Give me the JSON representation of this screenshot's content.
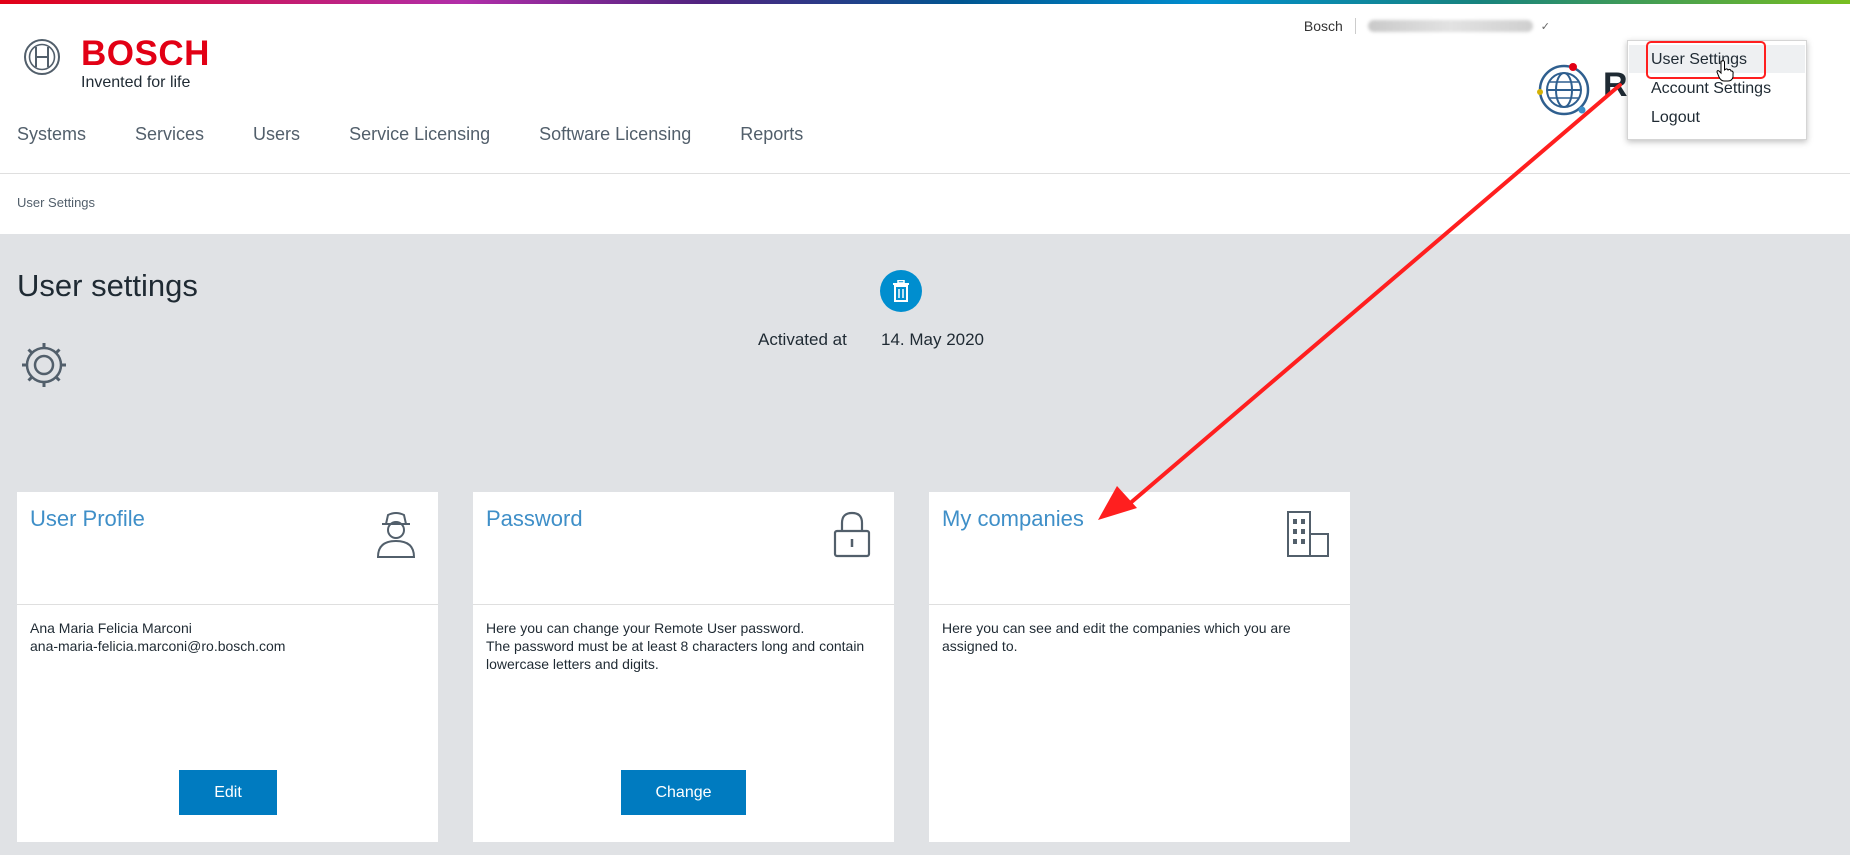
{
  "brand": {
    "name": "BOSCH",
    "tagline": "Invented for life"
  },
  "top_bar": {
    "company_link": "Bosch",
    "user_name": ""
  },
  "app": {
    "initial": "R"
  },
  "nav": {
    "items": [
      {
        "label": "Systems"
      },
      {
        "label": "Services"
      },
      {
        "label": "Users"
      },
      {
        "label": "Service Licensing"
      },
      {
        "label": "Software Licensing"
      },
      {
        "label": "Reports"
      }
    ]
  },
  "breadcrumb": {
    "current": "User Settings"
  },
  "page": {
    "title": "User settings",
    "activated_label": "Activated at",
    "activated_value": "14. May 2020"
  },
  "cards": {
    "profile": {
      "title": "User Profile",
      "name": "Ana Maria Felicia Marconi",
      "email": "ana-maria-felicia.marconi@ro.bosch.com",
      "button": "Edit"
    },
    "password": {
      "title": "Password",
      "line1": "Here you can change your Remote User password.",
      "line2": "The password must be at least 8 characters long and contain",
      "line3": "lowercase letters and digits.",
      "button": "Change"
    },
    "companies": {
      "title": "My companies",
      "line1": "Here you can see and edit the companies which you are",
      "line2": "assigned to."
    }
  },
  "user_menu": {
    "items": [
      {
        "label": "User Settings"
      },
      {
        "label": "Account Settings"
      },
      {
        "label": "Logout"
      }
    ]
  },
  "colors": {
    "brand_red": "#e20015",
    "accent_blue": "#007bc0",
    "title_blue": "#3f8fc8",
    "annotation_red": "#ff1f1f",
    "content_bg": "#e0e2e5"
  },
  "icons": {
    "logo": "bosch-armature-icon",
    "app": "globe-icon",
    "settings": "gear-icon",
    "delete": "trash-icon",
    "profile": "user-icon",
    "password": "lock-icon",
    "companies": "building-icon"
  }
}
